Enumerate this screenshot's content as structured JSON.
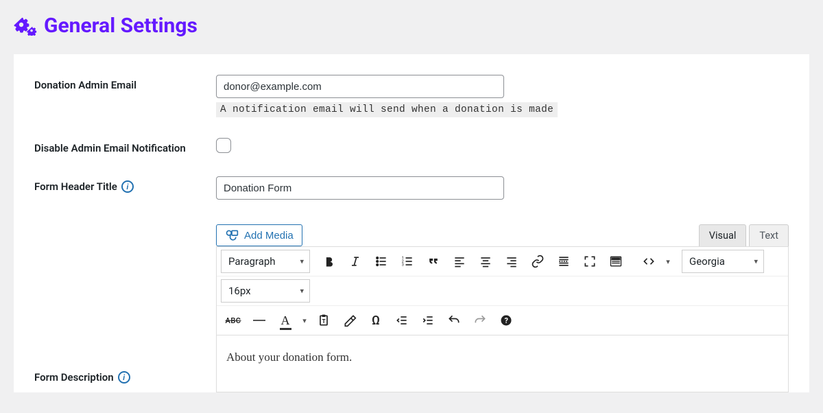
{
  "header": {
    "title": "General Settings"
  },
  "fields": {
    "admin_email": {
      "label": "Donation Admin Email",
      "value": "donor@example.com",
      "help": "A notification email will send when a donation is made"
    },
    "disable_notification": {
      "label": "Disable Admin Email Notification"
    },
    "form_header_title": {
      "label": "Form Header Title",
      "value": "Donation Form"
    },
    "form_description": {
      "label": "Form Description"
    }
  },
  "editor": {
    "add_media": "Add Media",
    "tabs": {
      "visual": "Visual",
      "text": "Text"
    },
    "format_select": "Paragraph",
    "font_family": "Georgia",
    "font_size": "16px",
    "content": "About your donation form."
  }
}
